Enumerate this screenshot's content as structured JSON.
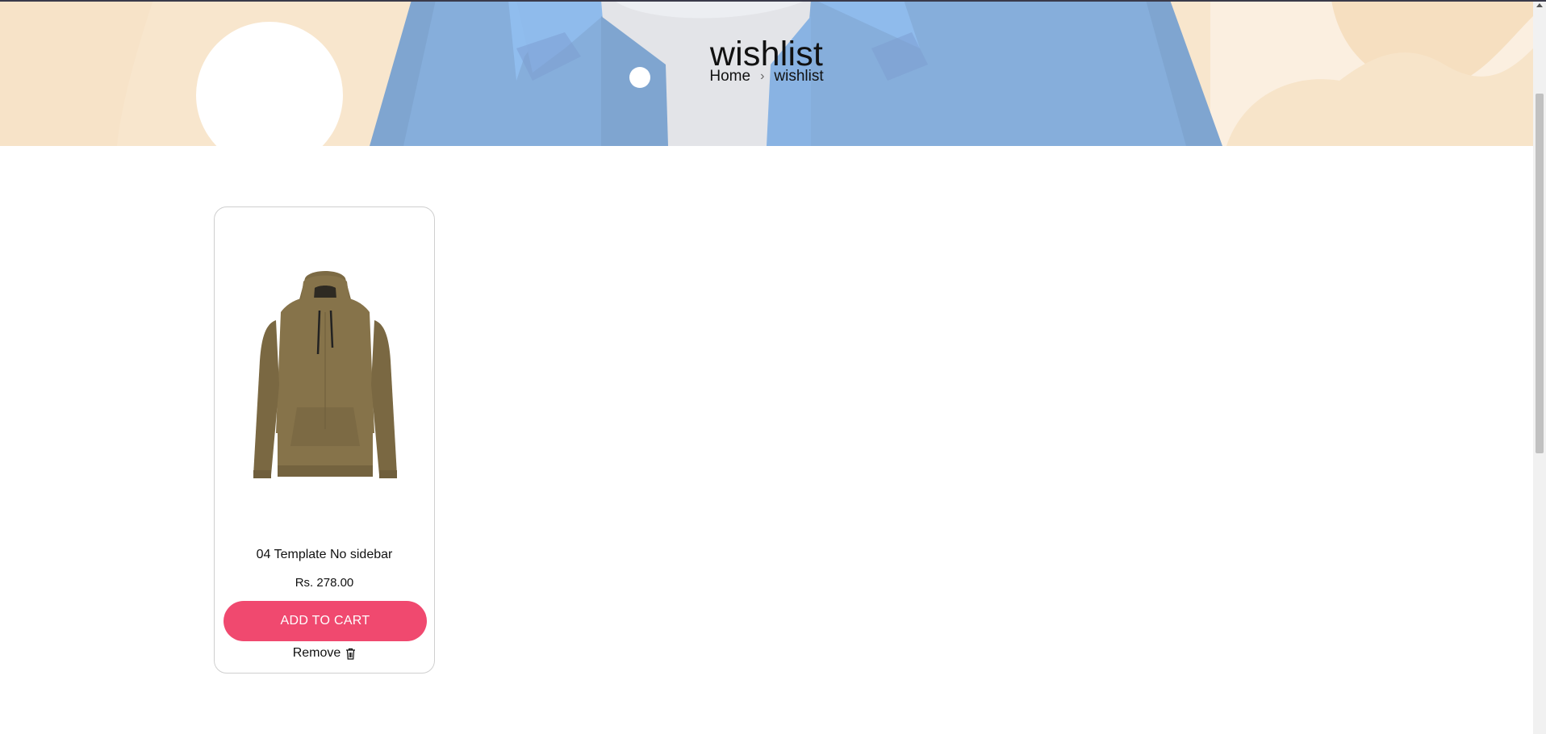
{
  "page": {
    "title": "wishlist",
    "breadcrumb": [
      {
        "label": "Home",
        "link": true
      },
      {
        "label": "wishlist",
        "link": false
      }
    ],
    "breadcrumb_separator": "›"
  },
  "wishlist": {
    "items": [
      {
        "name": "04 Template No sidebar",
        "price": "Rs. 278.00",
        "add_to_cart_label": "ADD TO CART",
        "remove_label": "Remove",
        "image_icon": "hoodie-image",
        "remove_icon": "trash-icon"
      }
    ]
  },
  "colors": {
    "accent": "#f0496f",
    "hero_bg": "#f8e6cd",
    "shirt_blue": "#86aedb",
    "card_border": "#cfcfcf"
  }
}
